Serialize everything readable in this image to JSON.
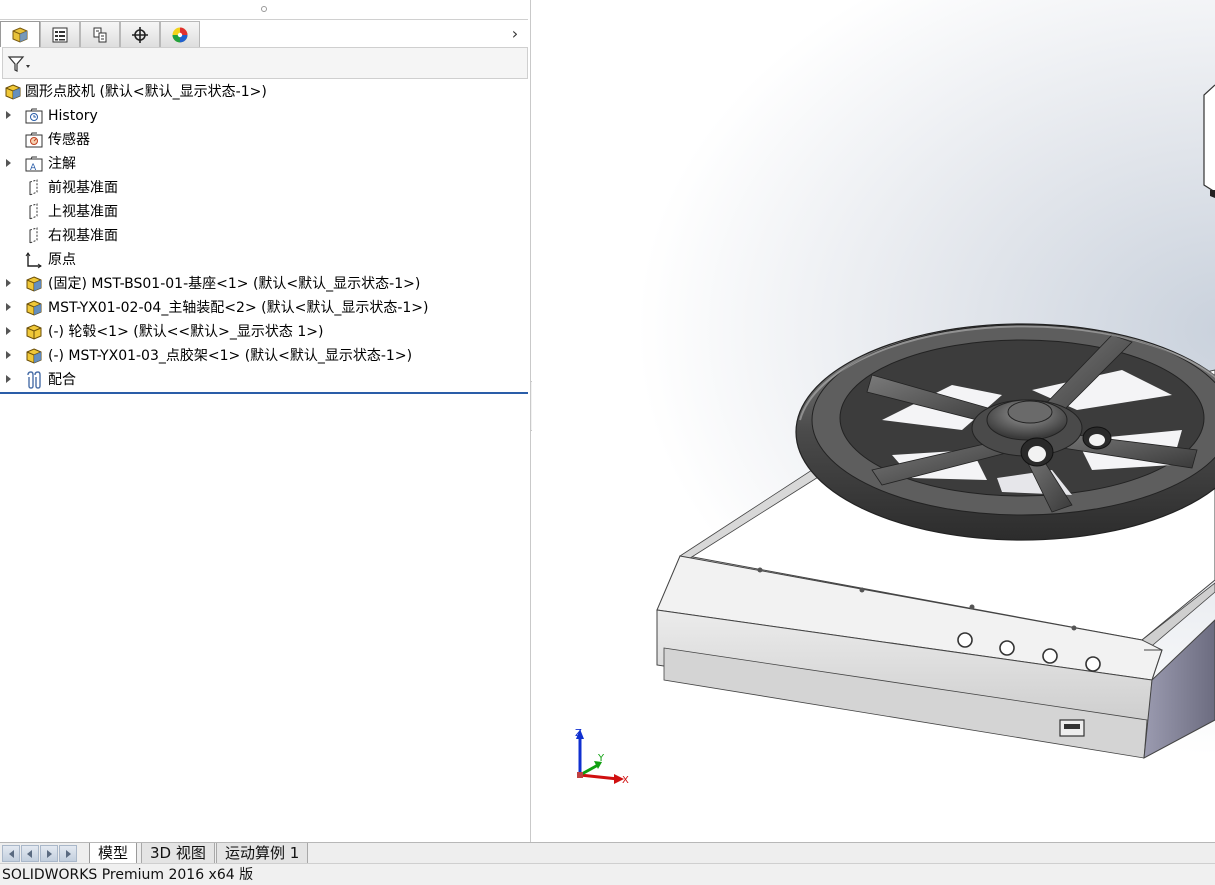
{
  "app": {
    "status": "SOLIDWORKS Premium 2016 x64 版"
  },
  "feature_tree": {
    "root_label": "圆形点胶机  (默认<默认_显示状态-1>)",
    "items": [
      {
        "label": "History",
        "icon": "history-folder-icon",
        "expandable": true
      },
      {
        "label": "传感器",
        "icon": "sensor-icon",
        "expandable": false
      },
      {
        "label": "注解",
        "icon": "annotation-icon",
        "expandable": true
      },
      {
        "label": "前视基准面",
        "icon": "plane-icon",
        "expandable": false
      },
      {
        "label": "上视基准面",
        "icon": "plane-icon",
        "expandable": false
      },
      {
        "label": "右视基准面",
        "icon": "plane-icon",
        "expandable": false
      },
      {
        "label": "原点",
        "icon": "origin-icon",
        "expandable": false
      },
      {
        "label": "(固定) MST-BS01-01-基座<1> (默认<默认_显示状态-1>)",
        "icon": "assembly-icon",
        "expandable": true
      },
      {
        "label": "MST-YX01-02-04_主轴装配<2> (默认<默认_显示状态-1>)",
        "icon": "assembly-icon",
        "expandable": true
      },
      {
        "label": "(-) 轮毂<1> (默认<<默认>_显示状态 1>)",
        "icon": "part-icon",
        "expandable": true
      },
      {
        "label": "(-) MST-YX01-03_点胶架<1> (默认<默认_显示状态-1>)",
        "icon": "assembly-icon",
        "expandable": true
      },
      {
        "label": "配合",
        "icon": "mates-icon",
        "expandable": true
      }
    ]
  },
  "manager_tabs": [
    {
      "icon": "feature-manager-icon",
      "active": true
    },
    {
      "icon": "property-manager-icon",
      "active": false
    },
    {
      "icon": "configuration-manager-icon",
      "active": false
    },
    {
      "icon": "dimxpert-manager-icon",
      "active": false
    },
    {
      "icon": "display-manager-icon",
      "active": false
    }
  ],
  "bottom_tabs": [
    {
      "label": "模型",
      "active": true
    },
    {
      "label": "3D 视图",
      "active": false
    },
    {
      "label": "运动算例 1",
      "active": false
    }
  ],
  "triad": {
    "x": "X",
    "y": "Y",
    "z": "Z"
  },
  "colors": {
    "accent": "#2a5da8",
    "axis_x": "#d01010",
    "axis_y": "#10a010",
    "axis_z": "#1030d0"
  }
}
